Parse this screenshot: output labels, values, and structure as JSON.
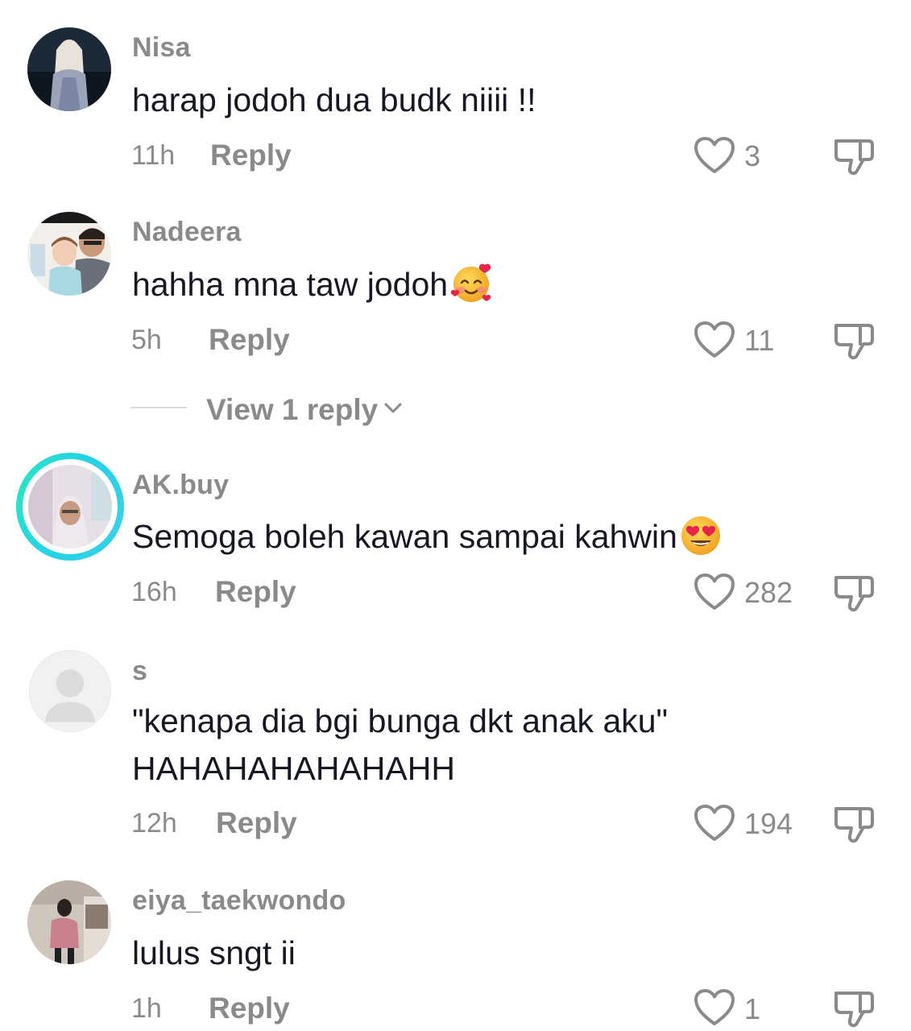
{
  "comments": [
    {
      "username": "Nisa",
      "text": "harap jodoh dua budk niiii !!",
      "time": "11h",
      "reply_label": "Reply",
      "likes": "3"
    },
    {
      "username": "Nadeera",
      "text": "hahha mna taw jodoh",
      "emoji": "smiling-face-with-hearts",
      "time": "5h",
      "reply_label": "Reply",
      "likes": "11",
      "view_replies_label": "View 1 reply"
    },
    {
      "username": "AK.buy",
      "text": "Semoga boleh kawan sampai kahwin",
      "emoji": "heart-eyes",
      "time": "16h",
      "reply_label": "Reply",
      "likes": "282",
      "story_ring_color": "#25d3e6"
    },
    {
      "username": "s",
      "text_line1": "\"kenapa dia bgi bunga dkt anak aku\"",
      "text_line2": "HAHAHAHAHAHAHH",
      "time": "12h",
      "reply_label": "Reply",
      "likes": "194"
    },
    {
      "username": "eiya_taekwondo",
      "text": "lulus sngt ii",
      "time": "1h",
      "reply_label": "Reply",
      "likes": "1"
    }
  ],
  "colors": {
    "text_primary": "#161823",
    "text_secondary": "#8a8a8a",
    "divider": "#d9d9d9"
  },
  "icons": {
    "like": "heart-outline-icon",
    "dislike": "thumbs-down-icon",
    "expand": "chevron-down-icon"
  }
}
